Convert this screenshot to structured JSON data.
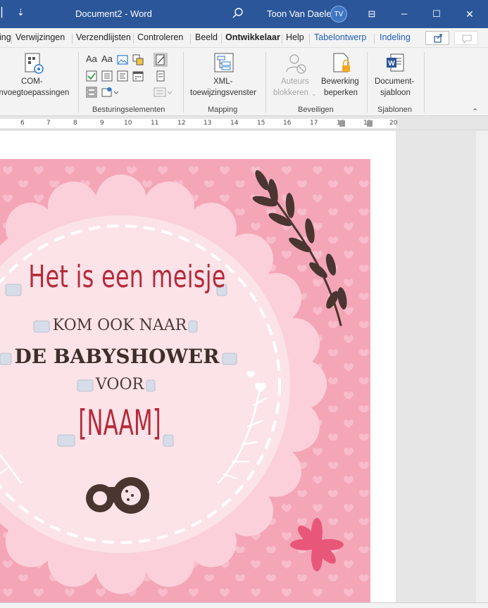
{
  "titlebar": {
    "quick_access_glyph": "⇣",
    "doc_title": "Document2 - Word",
    "user_name": "Toon Van Daele",
    "user_initials": "TV",
    "minimize_glyph": "–",
    "maximize_glyph": "☐",
    "close_glyph": "✕",
    "ribbon_display_glyph": "⊟"
  },
  "tabs": [
    {
      "label": "ing"
    },
    {
      "label": "Verwijzingen"
    },
    {
      "label": "Verzendlijsten"
    },
    {
      "label": "Controleren"
    },
    {
      "label": "Beeld"
    },
    {
      "label": "Ontwikkelaar"
    },
    {
      "label": "Help"
    },
    {
      "label": "Tabelontwerp"
    },
    {
      "label": "Indeling"
    }
  ],
  "ribbon": {
    "com_addins": {
      "line1": "COM-",
      "line2": "invoegtoepassingen"
    },
    "controls_group": "Besturingselementen",
    "xml_mapping": {
      "line1": "XML-",
      "line2": "toewijzingsvenster"
    },
    "mapping_group": "Mapping",
    "block_authors": {
      "line1": "Auteurs",
      "line2": "blokkeren"
    },
    "restrict_editing": {
      "line1": "Bewerking",
      "line2": "beperken"
    },
    "protect_group": "Beveiligen",
    "document_template": {
      "line1": "Document-",
      "line2": "sjabloon"
    },
    "templates_group": "Sjablonen",
    "collapse_glyph": "⌃"
  },
  "ruler": {
    "numbers": [
      "6",
      "7",
      "8",
      "9",
      "10",
      "11",
      "12",
      "13",
      "14",
      "15",
      "16",
      "17",
      "18",
      "19",
      "20"
    ]
  },
  "card": {
    "headline": "Het is een meisje",
    "line1": "KOM OOK NAAR",
    "line2": "DE BABYSHOWER",
    "line3": "VOOR",
    "name_placeholder": "[NAAM]"
  },
  "colors": {
    "title_bar": "#2b579a",
    "card_background": "#f4a6b6",
    "badge_circle": "#fbe3e8",
    "headline_red": "#b52a3a",
    "dark_brown": "#4a3a35"
  }
}
